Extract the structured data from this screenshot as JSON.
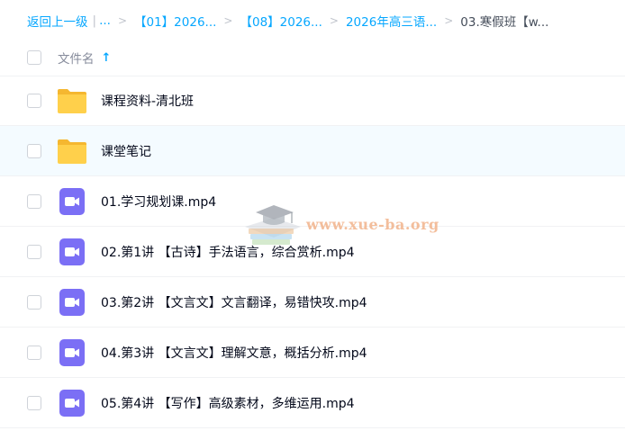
{
  "breadcrumb": {
    "back": "返回上一级",
    "ellipsis": "...",
    "items": [
      "【01】2026...",
      "【08】2026...",
      "2026年高三语..."
    ],
    "current": "03.寒假班【w..."
  },
  "header": {
    "column_name": "文件名",
    "sort_icon": "arrow-up-icon"
  },
  "files": [
    {
      "name": "课程资料-清北班",
      "type": "folder"
    },
    {
      "name": "课堂笔记",
      "type": "folder"
    },
    {
      "name": "01.学习规划课.mp4",
      "type": "video"
    },
    {
      "name": "02.第1讲 【古诗】手法语言，综合赏析.mp4",
      "type": "video"
    },
    {
      "name": "03.第2讲 【文言文】文言翻译，易错快攻.mp4",
      "type": "video"
    },
    {
      "name": "04.第3讲 【文言文】理解文意，概括分析.mp4",
      "type": "video"
    },
    {
      "name": "05.第4讲 【写作】高级素材，多维运用.mp4",
      "type": "video"
    }
  ],
  "watermark": {
    "text": "www.xue-ba.org"
  },
  "colors": {
    "accent": "#06a7ff",
    "folder": "#ffd04b",
    "video": "#7b6ff5",
    "hover_row": "#f4fbff"
  }
}
